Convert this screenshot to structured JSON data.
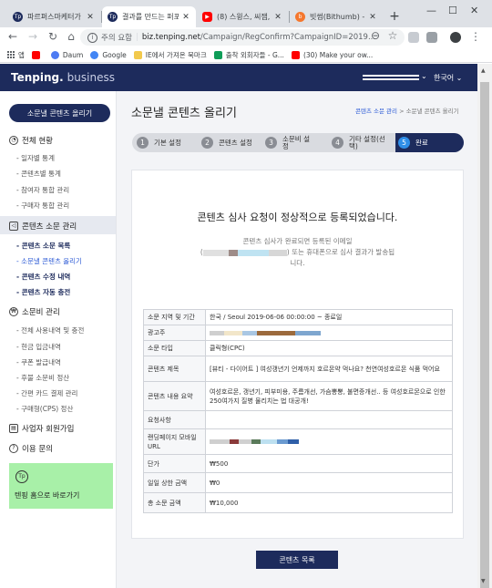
{
  "browser": {
    "tabs": [
      {
        "title": "파르퍼스마케터가",
        "icon": "tenping-favicon-icon",
        "active": false
      },
      {
        "title": "결과를 만드는 퍼포",
        "icon": "tenping-favicon-icon",
        "active": true
      },
      {
        "title": "(8) 스윙스, 씨잼, 코",
        "icon": "youtube-favicon-icon",
        "active": false
      },
      {
        "title": "빗썸(Bithumb) - 당",
        "icon": "bithumb-favicon-icon",
        "active": false
      }
    ],
    "address": {
      "security_label": "주의 요함",
      "domain": "biz.tenping.net",
      "path": "/Campaign/RegConfirm?CampaignID=2019..."
    },
    "bookmarks": [
      {
        "label": "앱",
        "icon": "apps-icon"
      },
      {
        "label": "",
        "icon": "youtube-bookmark-icon"
      },
      {
        "label": "Daum",
        "icon": "daum-icon"
      },
      {
        "label": "Google",
        "icon": "google-icon"
      },
      {
        "label": "IE에서 가져온 북마크",
        "icon": "folder-icon"
      },
      {
        "label": "출착 외회자들 - G...",
        "icon": "sheets-icon"
      },
      {
        "label": "(30) Make your ow...",
        "icon": "youtube-bookmark-icon"
      }
    ]
  },
  "header": {
    "logo": "Tenping.",
    "logo_sub": "business",
    "language": "한국어"
  },
  "sidebar": {
    "upload_button": "소문낼 콘텐츠 올리기",
    "sections": [
      {
        "label": "전체 현황",
        "icon": "dashboard-icon",
        "items": [
          "일자별 통계",
          "콘텐츠별 통계",
          "참여자 통합 관리",
          "구매자 통합 관리"
        ]
      },
      {
        "label": "콘텐츠 소문 관리",
        "icon": "megaphone-icon",
        "items": [
          "콘텐츠 소문 목록",
          "소문낼 콘텐츠 올리기",
          "콘텐츠 수정 내역",
          "콘텐츠 자동 충전"
        ]
      },
      {
        "label": "소문비 관리",
        "icon": "won-icon",
        "items": [
          "전체 사용내역 및 충전",
          "현금 입금내역",
          "쿠폰 발급내역",
          "후불 소문비 정산",
          "간편 카드 결제 관리",
          "구매형(CPS) 정산"
        ]
      },
      {
        "label": "사업자 회원가입",
        "icon": "business-icon",
        "items": []
      },
      {
        "label": "이용 문의",
        "icon": "question-icon",
        "items": []
      }
    ],
    "promo": "텐핑 홈으로 바로가기"
  },
  "main": {
    "title": "소문낼 콘텐츠 올리기",
    "breadcrumb": [
      "콘텐츠 소문 관리",
      ">",
      "소문낼 콘텐츠 올리기"
    ],
    "steps": [
      {
        "num": "1",
        "label": "기본 설정"
      },
      {
        "num": "2",
        "label": "콘텐츠 설정"
      },
      {
        "num": "3",
        "label": "소문비 설정"
      },
      {
        "num": "4",
        "label": "기타 설정(선택)"
      },
      {
        "num": "5",
        "label": "완료"
      }
    ],
    "heading": "콘텐츠 심사 요청이 정상적으로 등록되었습니다.",
    "message_line1": "콘텐츠 심사가 완료되면 등록된 이메일",
    "message_line2": ") 또는 휴대폰으로 심사 결과가 발송됩",
    "message_line3": "니다.",
    "rows": [
      {
        "label": "소문 지역 및 기간",
        "value": "한국 / Seoul 2019-06-06 00:00:00 ~ 종료일"
      },
      {
        "label": "광고주",
        "value": ""
      },
      {
        "label": "소문 타입",
        "value": "클릭형(CPC)"
      },
      {
        "label": "콘텐츠 제목",
        "value": "[뷰티 - 다이어트 ] 여성갱년기 언제까지 호르몬약 먹나요? 천연여성호르몬 식품 먹어요"
      },
      {
        "label": "콘텐츠 내용 요약",
        "value": "여성호르몬, 갱년기, 피부미용, 주름개선, 가슴뽕뽕, 불면증개선.. 등 여성호르몬으로 인한 250여가지 질병 물리치는 법 대공개!"
      },
      {
        "label": "요청사항",
        "value": ""
      },
      {
        "label": "랜딩페이지 모바일 URL",
        "value": ""
      },
      {
        "label": "단가",
        "value": "₩500"
      },
      {
        "label": "일일 상한 금액",
        "value": "₩0"
      },
      {
        "label": "총 소문 금액",
        "value": "₩10,000"
      }
    ],
    "list_button": "콘텐츠 목록"
  }
}
